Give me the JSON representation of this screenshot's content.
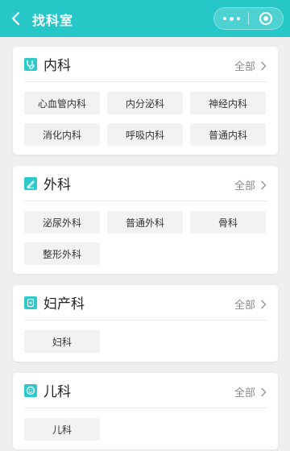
{
  "header": {
    "title": "找科室",
    "accent": "#27c7c8"
  },
  "sections": [
    {
      "title": "内科",
      "icon": "stethoscope-icon",
      "all_label": "全部",
      "tags": [
        "心血管内科",
        "内分泌科",
        "神经内科",
        "消化内科",
        "呼吸内科",
        "普通内科"
      ]
    },
    {
      "title": "外科",
      "icon": "scalpel-icon",
      "all_label": "全部",
      "tags": [
        "泌尿外科",
        "普通外科",
        "骨科",
        "整形外科"
      ]
    },
    {
      "title": "妇产科",
      "icon": "maternity-icon",
      "all_label": "全部",
      "tags": [
        "妇科"
      ]
    },
    {
      "title": "儿科",
      "icon": "child-face-icon",
      "all_label": "全部",
      "tags": [
        "儿科"
      ]
    }
  ]
}
